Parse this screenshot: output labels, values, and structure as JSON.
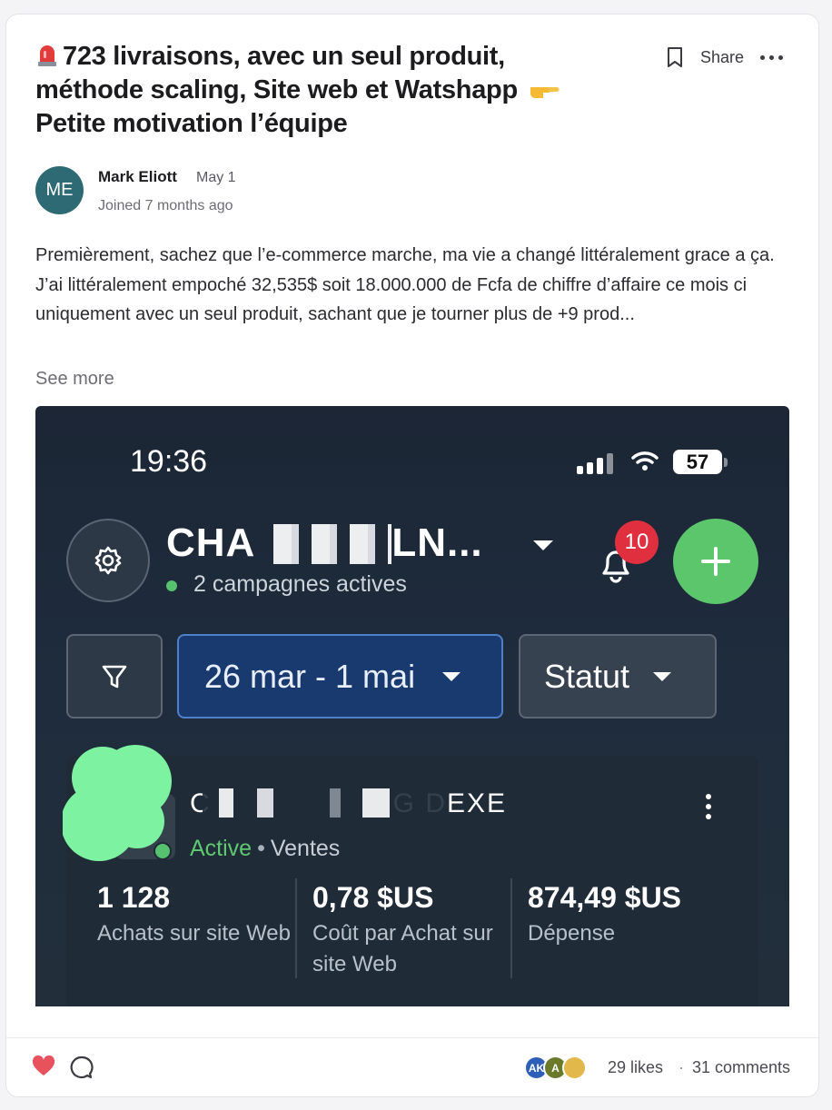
{
  "post": {
    "title_line1": "723 livraisons, avec un seul produit,",
    "title_line2": "méthode scaling, Site web et Watshapp",
    "title_line3": "Petite motivation l’équipe",
    "share_label": "Share",
    "author": {
      "initials": "ME",
      "name": "Mark Eliott",
      "date": "May 1",
      "joined": "Joined 7 months ago",
      "avatar_color": "#2e6a73"
    },
    "body": "Premièrement, sachez que l’e-commerce marche, ma vie a changé littéralement grace a ça. J’ai littéralement empoché 32,535$ soit 18.000.000 de Fcfa de chiffre d’affaire ce mois ci uniquement avec un seul produit, sachant que je tourner plus de +9 prod...",
    "see_more": "See more"
  },
  "screenshot": {
    "time": "19:36",
    "battery": "57",
    "account_name": "CHA",
    "account_name_tail": "LN...",
    "active_campaigns": "2 campagnes actives",
    "notification_count": "10",
    "date_range": "26 mar - 1 mai",
    "status_filter": "Statut",
    "campaign": {
      "name_prefix": "C",
      "name_suffix": "G DEXE",
      "status": "Active",
      "separator": "•",
      "type": "Ventes",
      "metrics": [
        {
          "value": "1 128",
          "label": "Achats sur site Web"
        },
        {
          "value": "0,78 $US",
          "label": "Coût par Achat sur site Web"
        },
        {
          "value": "874,49 $US",
          "label": "Dépense"
        }
      ]
    },
    "colors": {
      "accent_green": "#5cc66d",
      "badge_red": "#e0303f",
      "date_blue": "#183a6e"
    }
  },
  "footer": {
    "reactors": [
      {
        "initials": "AK",
        "color": "#2e5fb8"
      },
      {
        "initials": "A",
        "color": "#6b7a2a"
      },
      {
        "initials": "",
        "color": "#e2b84a"
      }
    ],
    "likes": "29 likes",
    "separator": "·",
    "comments": "31 comments"
  }
}
